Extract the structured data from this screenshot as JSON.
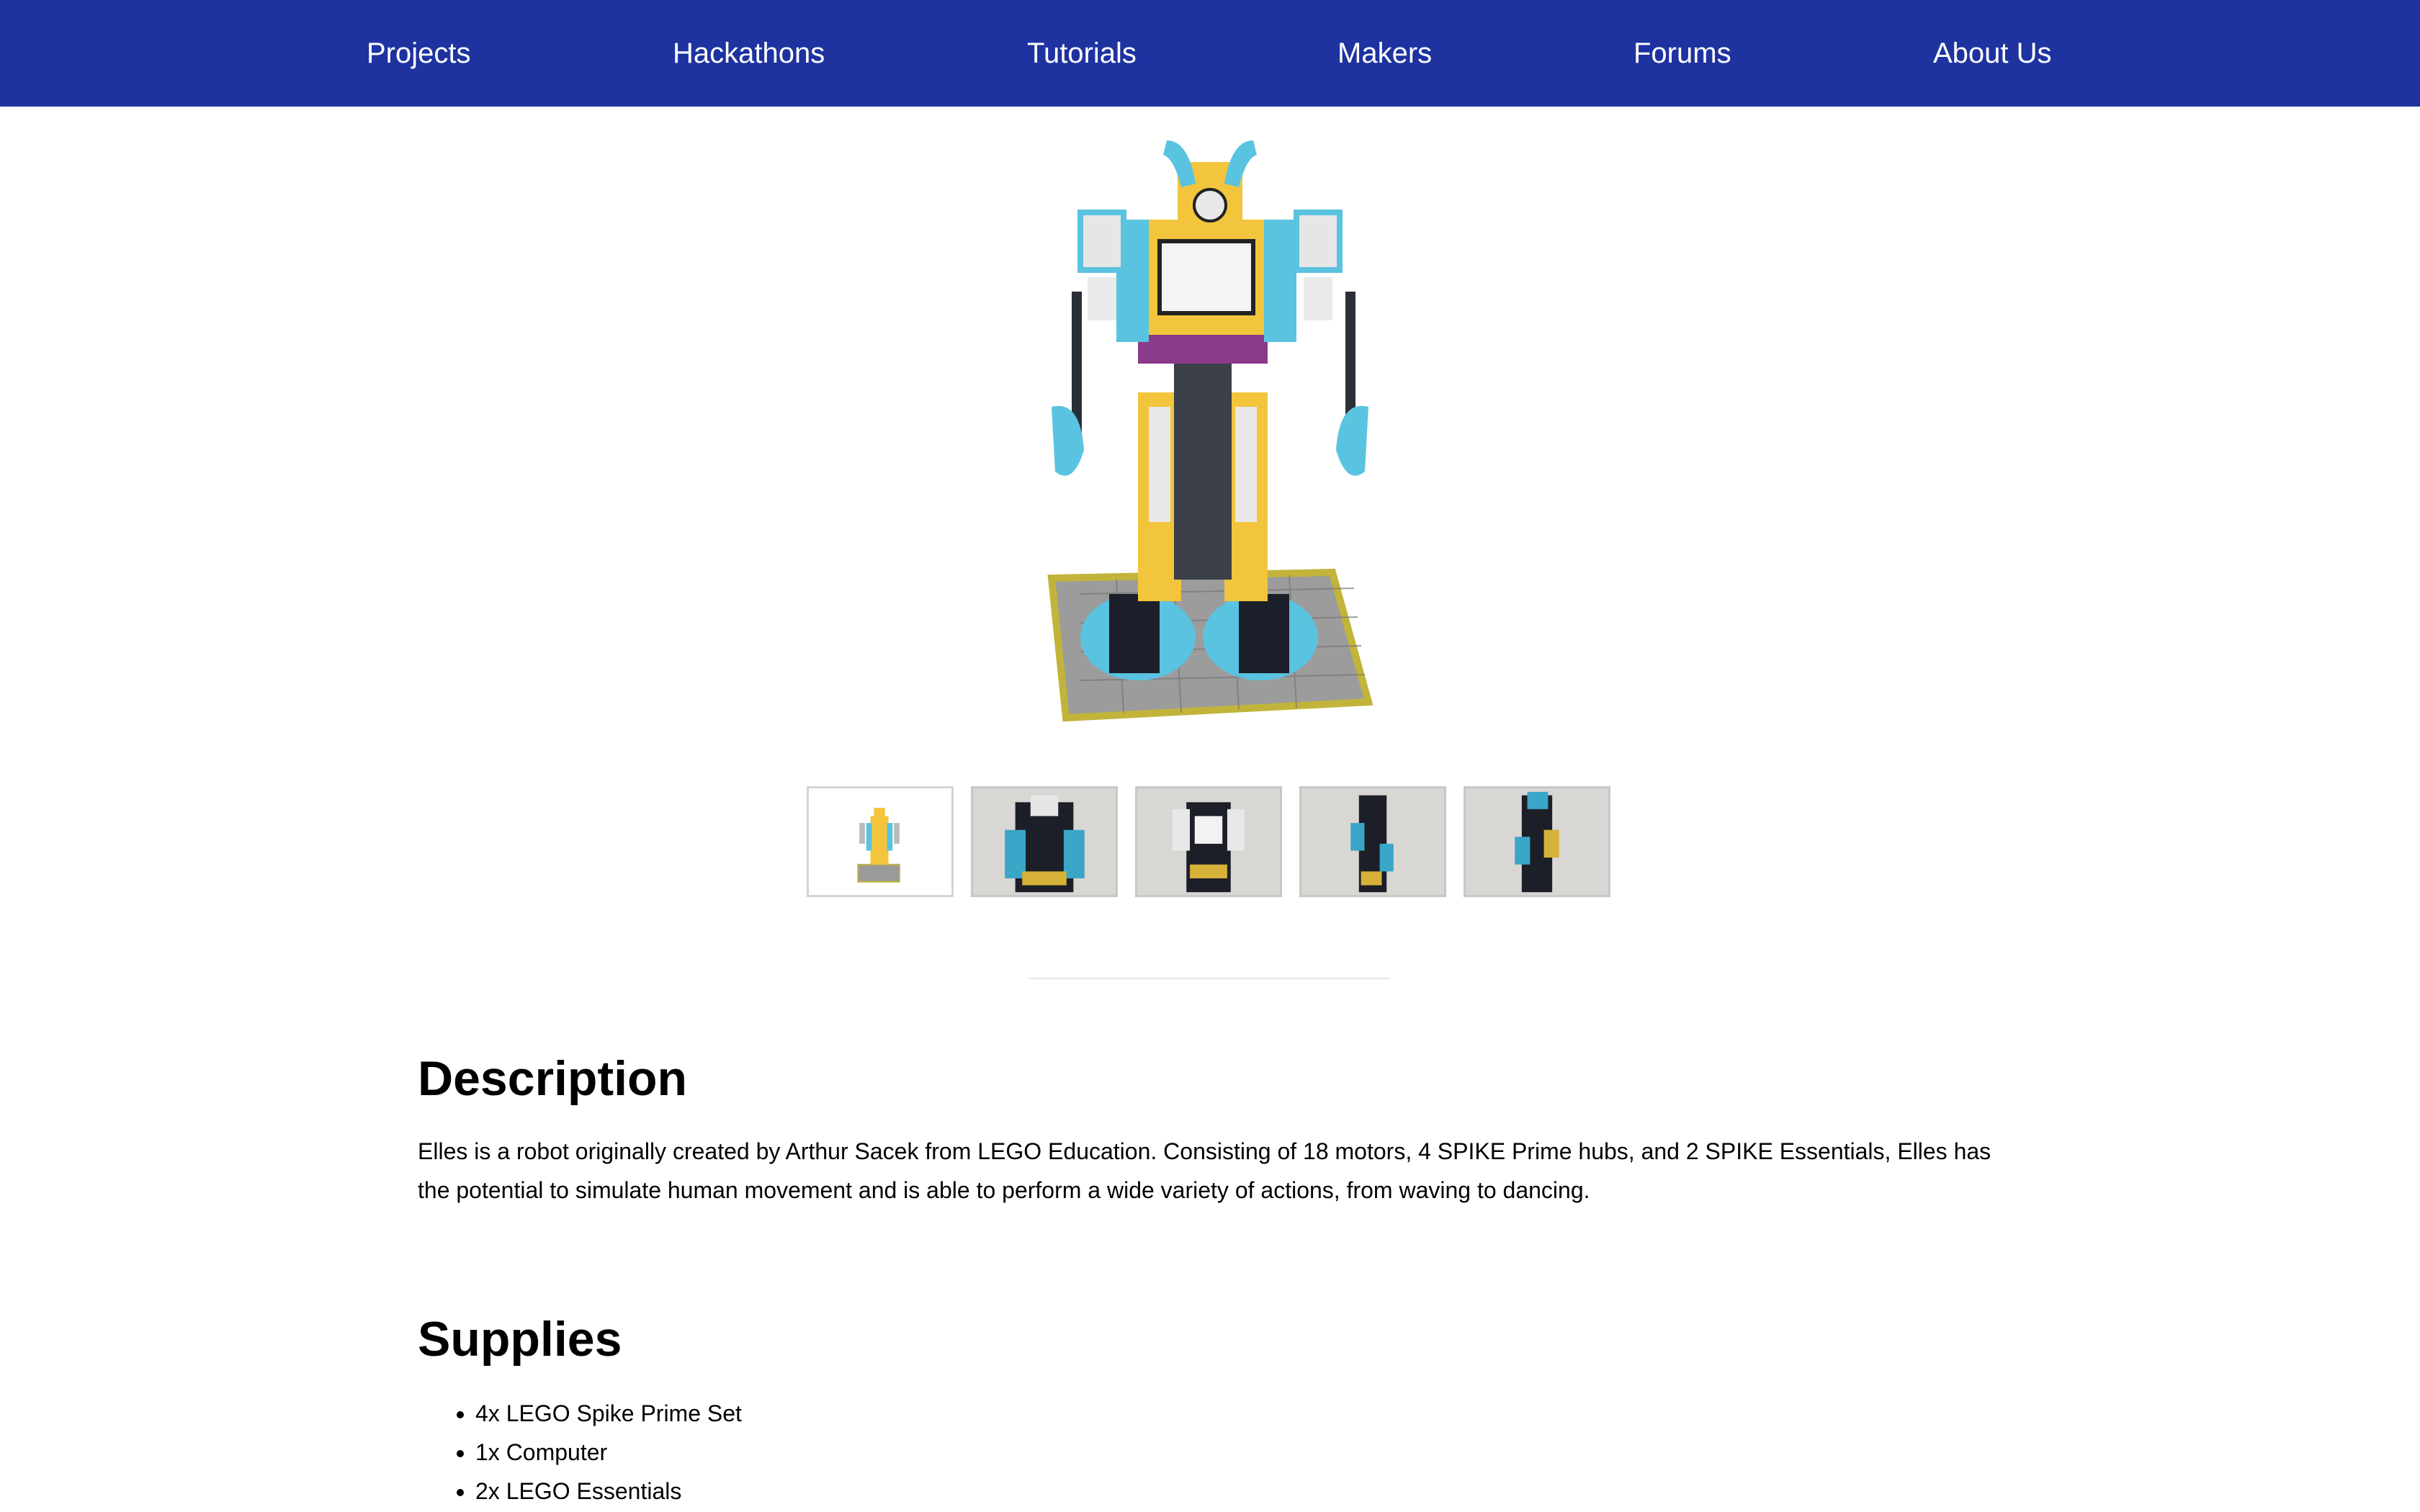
{
  "nav": {
    "items": [
      {
        "label": "Projects"
      },
      {
        "label": "Hackathons"
      },
      {
        "label": "Tutorials"
      },
      {
        "label": "Makers"
      },
      {
        "label": "Forums"
      },
      {
        "label": "About Us"
      }
    ],
    "background": "#1e33a0"
  },
  "gallery": {
    "thumbnail_count": 5,
    "selected_index": 0
  },
  "description": {
    "heading": "Description",
    "text": "Elles is a robot originally created by Arthur Sacek from LEGO Education. Consisting of 18 motors, 4 SPIKE Prime hubs, and 2 SPIKE Essentials, Elles has the potential to simulate human movement and is able to perform a wide variety of actions, from waving to dancing."
  },
  "supplies": {
    "heading": "Supplies",
    "items": [
      "4x LEGO Spike Prime Set",
      "1x Computer",
      "2x LEGO Essentials"
    ]
  }
}
